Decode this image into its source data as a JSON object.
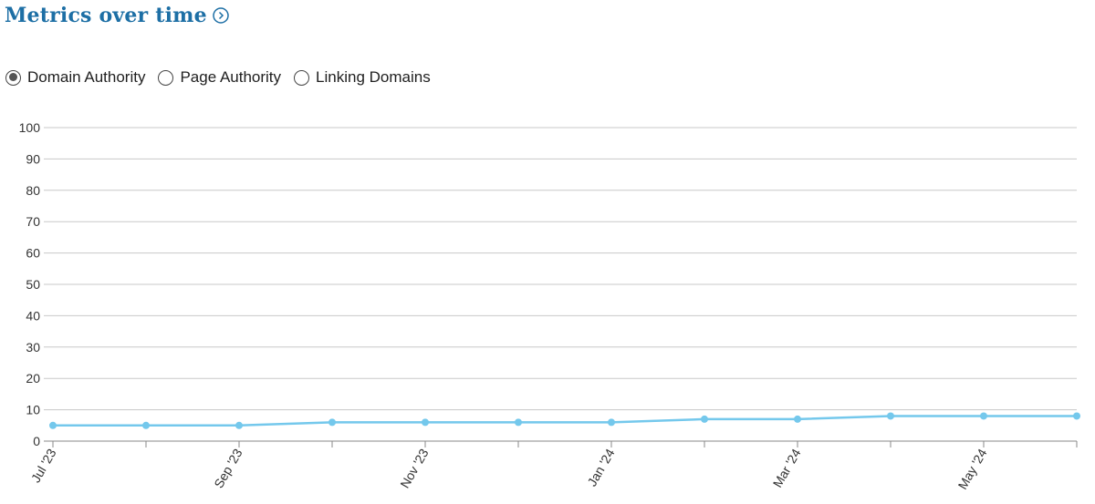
{
  "header": {
    "title": "Metrics over time",
    "info_icon": "chevron-right-circle-icon"
  },
  "metric_options": [
    {
      "label": "Domain Authority",
      "selected": true
    },
    {
      "label": "Page Authority",
      "selected": false
    },
    {
      "label": "Linking Domains",
      "selected": false
    }
  ],
  "colors": {
    "title": "#1d6fa5",
    "series": "#74c8ec",
    "grid": "#c8c8c8",
    "axis": "#888888"
  },
  "chart_data": {
    "type": "line",
    "x": [
      "Jul '23",
      "Aug '23",
      "Sep '23",
      "Oct '23",
      "Nov '23",
      "Dec '23",
      "Jan '24",
      "Feb '24",
      "Mar '24",
      "Apr '24",
      "May '24",
      "Jun '24"
    ],
    "x_tick_labels": [
      "Jul '23",
      "",
      "Sep '23",
      "",
      "Nov '23",
      "",
      "Jan '24",
      "",
      "Mar '24",
      "",
      "May '24",
      ""
    ],
    "series": [
      {
        "values": [
          5,
          5,
          5,
          6,
          6,
          6,
          6,
          7,
          7,
          8,
          8,
          8
        ]
      }
    ],
    "y_ticks": [
      0,
      10,
      20,
      30,
      40,
      50,
      60,
      70,
      80,
      90,
      100
    ],
    "ylim": [
      0,
      100
    ],
    "grid": true,
    "legend": "none"
  }
}
